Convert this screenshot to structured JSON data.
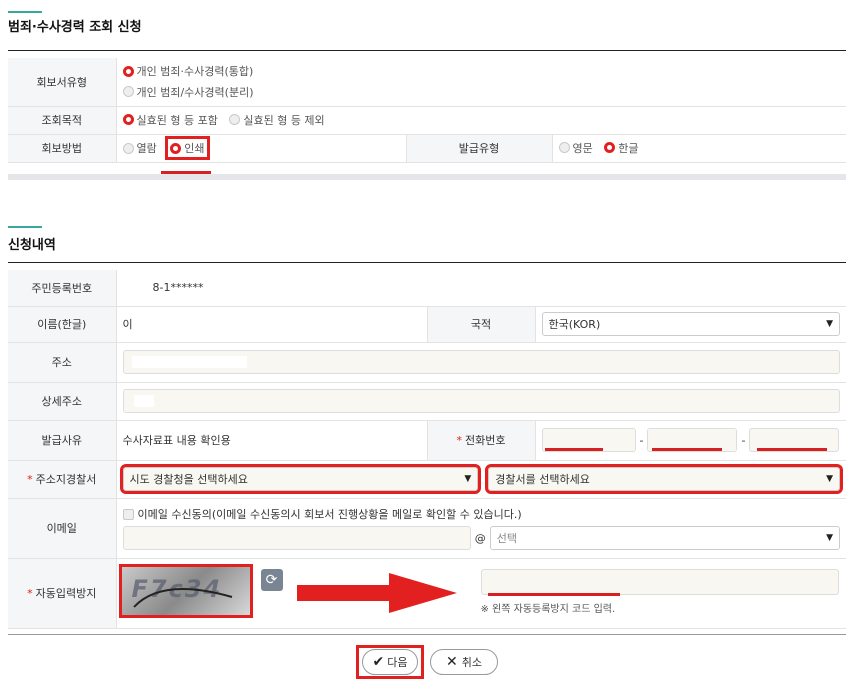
{
  "section1": {
    "title": "범죄·수사경력 조회 신청",
    "report_type": {
      "label": "회보서유형",
      "options": [
        "개인 범죄·수사경력(통합)",
        "개인 범죄/수사경력(분리)"
      ]
    },
    "purpose": {
      "label": "조회목적",
      "options": [
        "실효된 형 등 포함",
        "실효된 형 등 제외"
      ]
    },
    "method": {
      "label": "회보방법",
      "options": [
        "열람",
        "인쇄"
      ]
    },
    "issue_type": {
      "label": "발급유형",
      "options": [
        "영문",
        "한글"
      ]
    }
  },
  "section2": {
    "title": "신청내역",
    "rrn": {
      "label": "주민등록번호",
      "value": "8-1******"
    },
    "name": {
      "label": "이름(한글)",
      "value": "이"
    },
    "nationality": {
      "label": "국적",
      "value": "한국(KOR)"
    },
    "address": {
      "label": "주소"
    },
    "detail_address": {
      "label": "상세주소"
    },
    "reason": {
      "label": "발급사유",
      "value": "수사자료표 내용 확인용"
    },
    "phone": {
      "label": "전화번호",
      "sep": "-"
    },
    "police": {
      "label": "주소지경찰서",
      "province_placeholder": "시도 경찰청을 선택하세요",
      "station_placeholder": "경찰서를 선택하세요"
    },
    "email": {
      "label": "이메일",
      "consent": "이메일 수신동의(이메일 수신동의시 회보서 진행상황을 메일로 확인할 수 있습니다.)",
      "at": "@",
      "domain_placeholder": "선택"
    },
    "captcha": {
      "label": "자동입력방지",
      "image_text": "F7c34",
      "hint": "※ 왼쪽 자동등록방지 코드 입력."
    }
  },
  "buttons": {
    "next": "다음",
    "cancel": "취소"
  },
  "colors": {
    "accent": "#3aa6a0",
    "highlight": "#e32020",
    "label_bg": "#f4f6f8"
  }
}
